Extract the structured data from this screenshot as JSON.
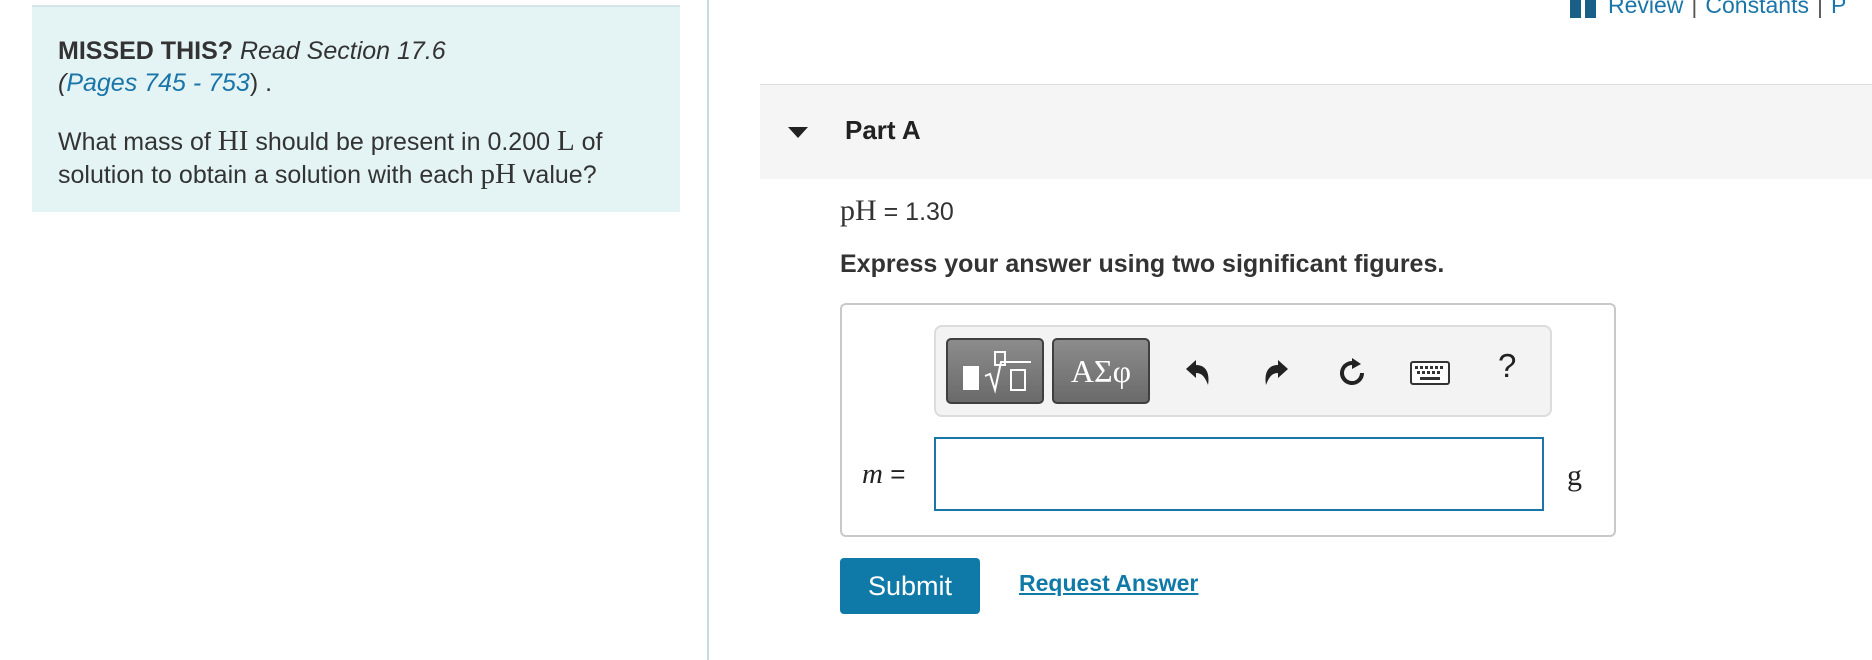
{
  "intro": {
    "missed_label": "MISSED THIS?",
    "read_section": "Read Section 17.6",
    "pages_open": "(",
    "pages_link": "Pages 745 - 753",
    "pages_close": ") .",
    "question_part1": "What mass of",
    "question_species": "HI",
    "question_part2": "should be present in 0.200",
    "question_unit": "L",
    "question_part3": "of solution to obtain a solution with each",
    "question_ph": "pH",
    "question_part4": "value?"
  },
  "top_links": {
    "review": "Review",
    "separator": "|",
    "constants": "Constants",
    "cut_off": "P"
  },
  "part": {
    "title": "Part A",
    "ph_symbol": "pH",
    "ph_value": "= 1.30",
    "instruction": "Express your answer using two significant figures."
  },
  "toolbar": {
    "greek_label": "ΑΣφ",
    "help_label": "?"
  },
  "answer": {
    "variable": "m",
    "equals": "=",
    "value": "",
    "unit": "g"
  },
  "actions": {
    "submit": "Submit",
    "request_answer": "Request Answer"
  },
  "colors": {
    "link": "#1a75a8",
    "submit_bg": "#0f7aa7",
    "intro_bg": "#e4f4f5"
  }
}
